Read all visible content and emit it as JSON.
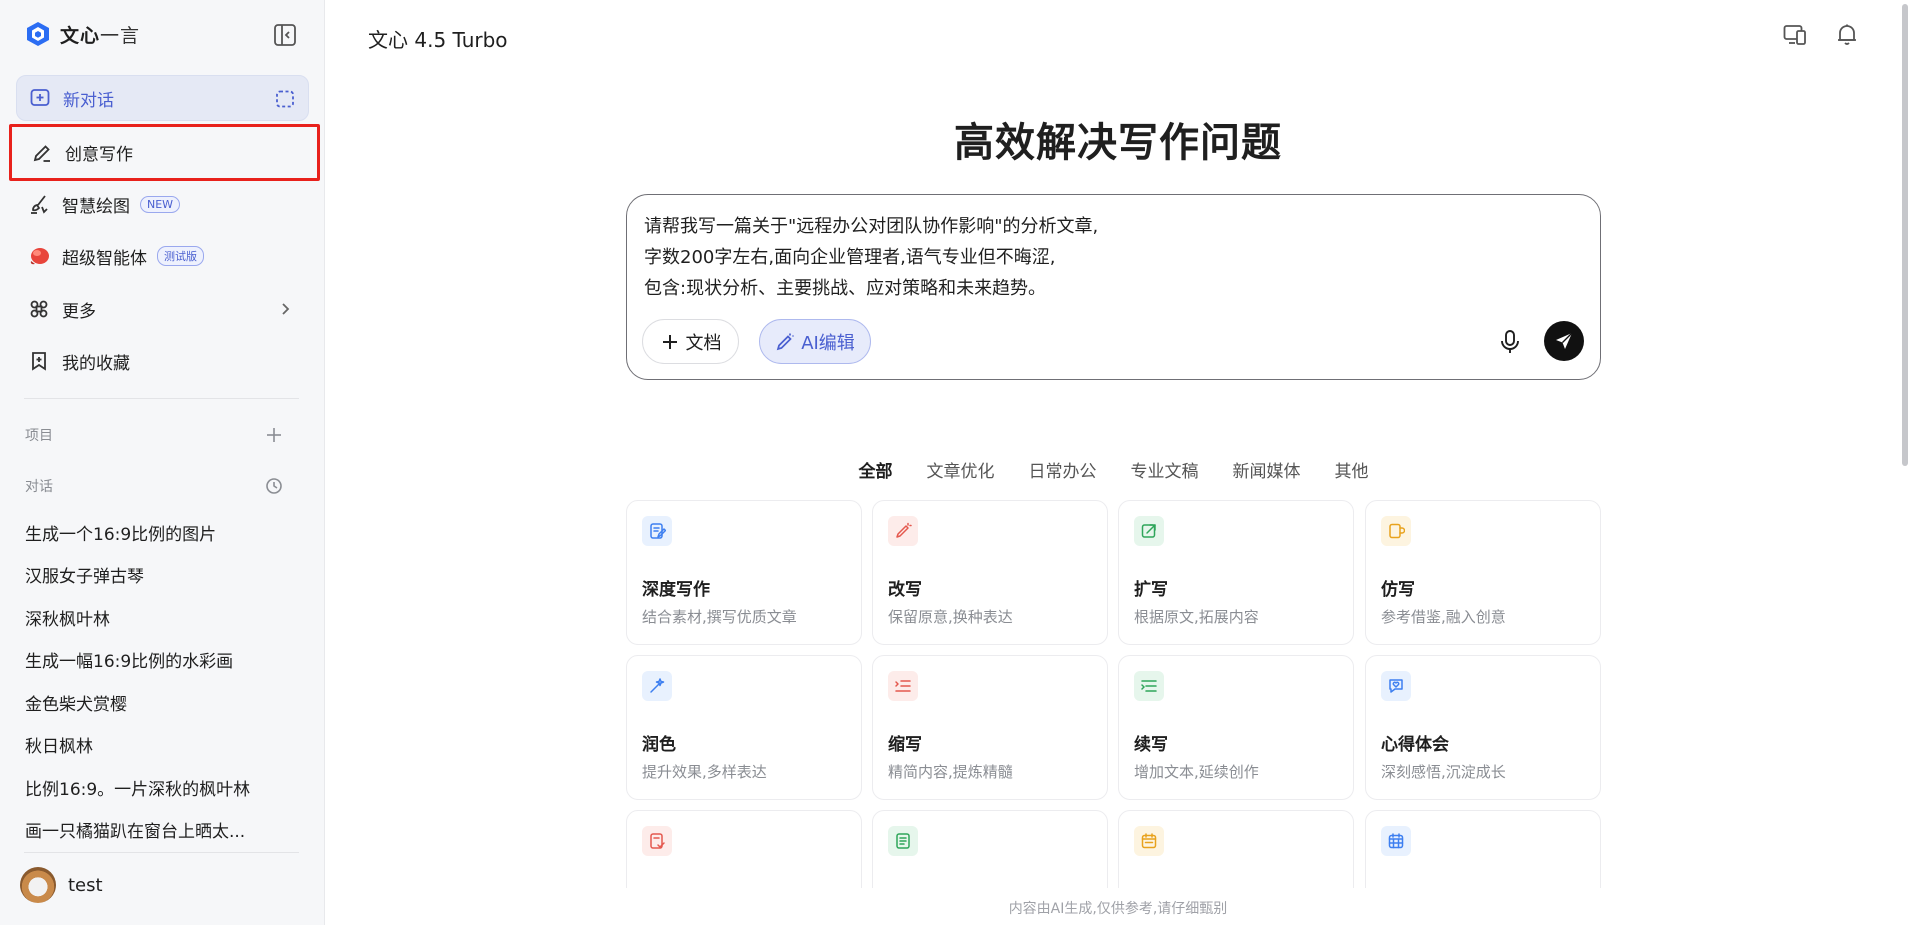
{
  "sidebar": {
    "logo": {
      "brand": "文心",
      "suffix": "一言"
    },
    "nav": {
      "new_chat": "新对话",
      "creative_writing": "创意写作",
      "smart_drawing": "智慧绘图",
      "smart_drawing_badge": "NEW",
      "super_agent": "超级智能体",
      "super_agent_badge": "测试版",
      "more": "更多",
      "favorites": "我的收藏"
    },
    "sections": {
      "projects": "项目",
      "conversations": "对话"
    },
    "history": [
      "生成一个16:9比例的图片",
      "汉服女子弹古琴",
      "深秋枫叶林",
      "生成一幅16:9比例的水彩画",
      "金色柴犬赏樱",
      "秋日枫林",
      "比例16:9。一片深秋的枫叶林",
      "画一只橘猫趴在窗台上晒太..."
    ],
    "user": {
      "name": "test"
    }
  },
  "main": {
    "model": "文心 4.5 Turbo",
    "hero": "高效解决写作问题",
    "prompt_lines": [
      "请帮我写一篇关于\"远程办公对团队协作影响\"的分析文章,",
      "字数200字左右,面向企业管理者,语气专业但不晦涩,",
      "包含:现状分析、主要挑战、应对策略和未来趋势。"
    ],
    "doc_button": "文档",
    "ai_edit_button": "AI编辑",
    "tabs": [
      "全部",
      "文章优化",
      "日常办公",
      "专业文稿",
      "新闻媒体",
      "其他"
    ],
    "cards": [
      {
        "title": "深度写作",
        "desc": "结合素材,撰写优质文章",
        "icon": "doc-pen-icon",
        "color": "#3d7ff0",
        "bg": "#e8f1fe"
      },
      {
        "title": "改写",
        "desc": "保留原意,换种表达",
        "icon": "magic-pen-icon",
        "color": "#e4584e",
        "bg": "#fdecea"
      },
      {
        "title": "扩写",
        "desc": "根据原文,拓展内容",
        "icon": "expand-icon",
        "color": "#2fa55a",
        "bg": "#e6f6ec"
      },
      {
        "title": "仿写",
        "desc": "参考借鉴,融入创意",
        "icon": "copy-doc-icon",
        "color": "#e8a21c",
        "bg": "#fdf4e0"
      },
      {
        "title": "润色",
        "desc": "提升效果,多样表达",
        "icon": "wand-icon",
        "color": "#3d7ff0",
        "bg": "#e8f1fe"
      },
      {
        "title": "缩写",
        "desc": "精简内容,提炼精髓",
        "icon": "shrink-lines-icon",
        "color": "#e4584e",
        "bg": "#fdecea"
      },
      {
        "title": "续写",
        "desc": "增加文本,延续创作",
        "icon": "continue-lines-icon",
        "color": "#2fa55a",
        "bg": "#e6f6ec"
      },
      {
        "title": "心得体会",
        "desc": "深刻感悟,沉淀成长",
        "icon": "chat-heart-icon",
        "color": "#3d7ff0",
        "bg": "#e8f1fe"
      },
      {
        "title": "",
        "desc": "",
        "icon": "doc-check-icon",
        "color": "#e4584e",
        "bg": "#fdecea"
      },
      {
        "title": "",
        "desc": "",
        "icon": "doc-list-icon",
        "color": "#2fa55a",
        "bg": "#e6f6ec"
      },
      {
        "title": "",
        "desc": "",
        "icon": "calendar-icon",
        "color": "#e8a21c",
        "bg": "#fdf4e0"
      },
      {
        "title": "",
        "desc": "",
        "icon": "calendar-grid-icon",
        "color": "#3d7ff0",
        "bg": "#e8f1fe"
      }
    ],
    "footer": "内容由AI生成,仅供参考,请仔细甄别"
  },
  "colors": {
    "accent": "#4a5fd0",
    "highlight_border": "#e8211c"
  }
}
